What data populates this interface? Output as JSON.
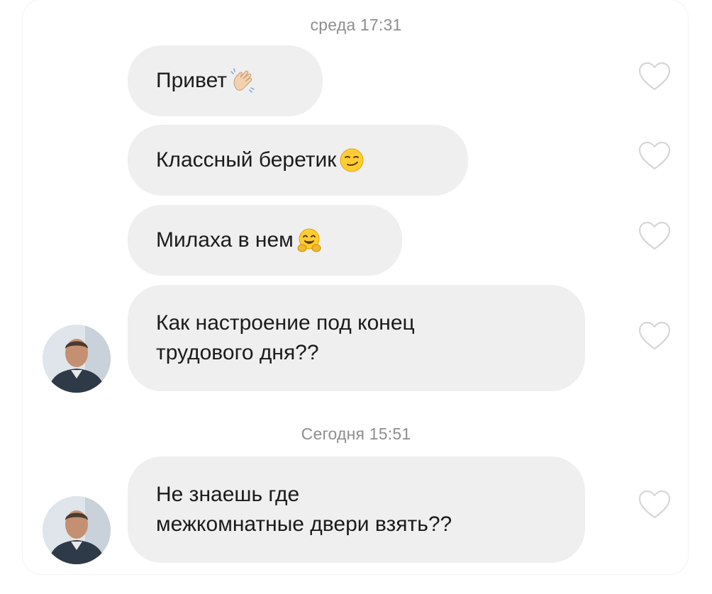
{
  "timestamps": {
    "first": "среда 17:31",
    "second": "Сегодня 15:51"
  },
  "messages": [
    {
      "text": "Привет",
      "emoji": "waving-hand"
    },
    {
      "text": "Классный беретик",
      "emoji": "smirking-face"
    },
    {
      "text": "Милаха в нем",
      "emoji": "hugging-face"
    },
    {
      "text": "Как настроение под конец\nтрудового дня??",
      "emoji": ""
    },
    {
      "text": "Не знаешь где\nмежкомнатные двери взять??",
      "emoji": ""
    }
  ],
  "icons": {
    "like": "heart-outline-icon",
    "avatar": "sender-avatar"
  },
  "colors": {
    "bubble": "#efefef",
    "text": "#1b1b1b",
    "timestamp": "#8e8e8e",
    "heart_stroke": "#d6d6d6"
  }
}
